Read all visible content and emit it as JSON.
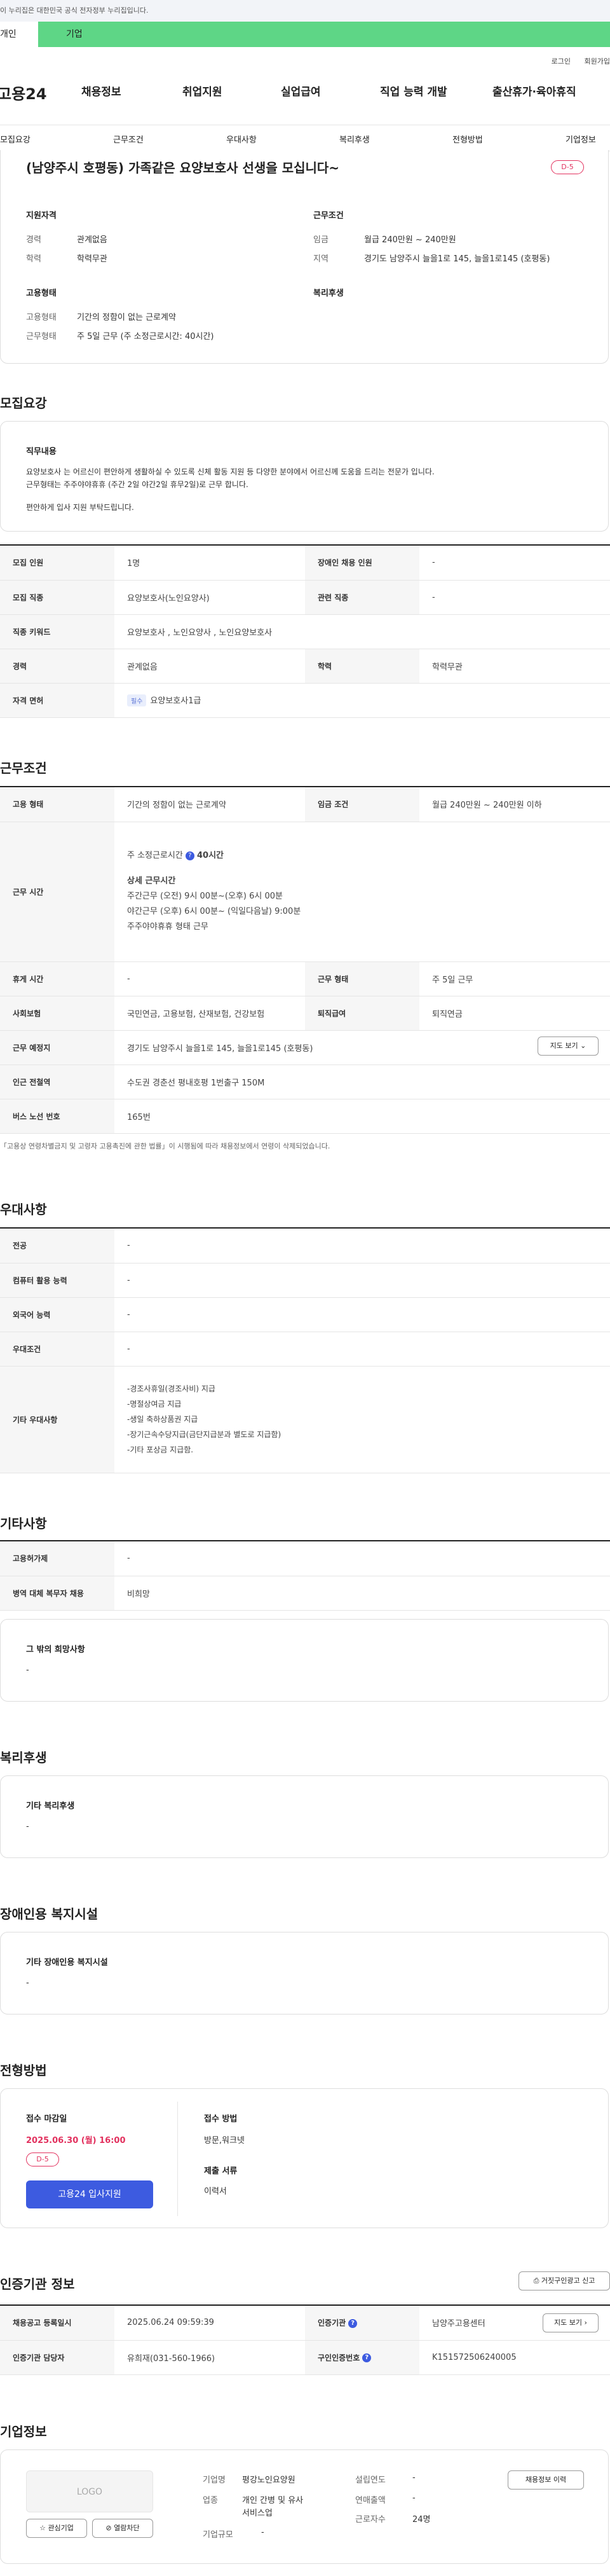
{
  "gov_banner": "이 누리집은 대한민국 공식 전자정부 누리집입니다.",
  "tabs": {
    "individual": "개인",
    "corporate": "기업"
  },
  "util": {
    "login": "로그인",
    "signup": "회원가입"
  },
  "logo": "고용24",
  "gnb": [
    "채용정보",
    "취업지원",
    "실업급여",
    "직업 능력 개발",
    "출산휴가·육아휴직"
  ],
  "lnb": [
    "모집요강",
    "근무조건",
    "우대사항",
    "복리후생",
    "전형방법",
    "기업정보"
  ],
  "title_card": {
    "title": "(남양주시 호평동) 가족같은 요양보호사 선생을 모십니다~",
    "dday": "D-5",
    "qual_h": "지원자격",
    "career_l": "경력",
    "career_v": "관계없음",
    "edu_l": "학력",
    "edu_v": "학력무관",
    "work_h": "근무조건",
    "wage_l": "임금",
    "wage_v": "월급 240만원 ~ 240만원",
    "area_l": "지역",
    "area_v": "경기도 남양주시 늘을1로 145, 늘을1로145 (호평동)",
    "emp_h": "고용형태",
    "emptype_l": "고용형태",
    "emptype_v": "기간의 정함이 없는 근로계약",
    "worktype_l": "근무형태",
    "worktype_v": "주 5일 근무 (주 소정근로시간: 40시간)",
    "welfare_h": "복리후생"
  },
  "recruit": {
    "h": "모집요강",
    "duty_h": "직무내용",
    "duty_1": "요양보호사 는 어르신이 편안하게 생활하실 수 있도록 신체 활동 지원 등 다양한 분야에서 어르신께 도움을 드리는 전문가 입니다.",
    "duty_2": "근무형태는 주주야야휴휴 (주간 2일 야간2일 휴무2일)로 근무 합니다.",
    "duty_3": "편안하게 입사 지원 부탁드립니다.",
    "rows": [
      [
        "모집 인원",
        "1명",
        "장애인 채용 인원",
        "-"
      ],
      [
        "모집 직종",
        "요양보호사(노인요양사)",
        "관련 직종",
        "-"
      ],
      [
        "직종 키워드",
        "요양보호사 , 노인요양사 , 노인요양보호사",
        "",
        ""
      ],
      [
        "경력",
        "관계없음",
        "학력",
        "학력무관"
      ]
    ],
    "license_l": "자격 면허",
    "license_tag": "필수",
    "license_v": "요양보호사1급"
  },
  "cond": {
    "h": "근무조건",
    "emptype_l": "고용 형태",
    "emptype_v": "기간의 정함이 없는 근로계약",
    "wage_l": "임금 조건",
    "wage_v": "월급 240만원 ~ 240만원 이하",
    "hours_l": "근무 시간",
    "hours_1": "주 소정근로시간",
    "hours_1b": "40시간",
    "hours_2": "상세 근무시간",
    "hours_3": "주간근무 (오전) 9시 00분~(오후) 6시 00분",
    "hours_4": "야간근무 (오후) 6시 00분~ (익일다음날) 9:00분",
    "hours_5": "주주야야휴휴 형태 근무",
    "rows": [
      [
        "휴게 시간",
        "-",
        "근무 형태",
        "주 5일 근무"
      ],
      [
        "사회보험",
        "국민연금, 고용보험, 산재보험, 건강보험",
        "퇴직급여",
        "퇴직연금"
      ]
    ],
    "place_l": "근무 예정지",
    "place_v": "경기도 남양주시 늘을1로 145, 늘을1로145 (호평동)",
    "map_btn": "지도 보기",
    "subway_l": "인근 전철역",
    "subway_v": "수도권 경춘선 평내호평 1번출구 150M",
    "bus_l": "버스 노선 번호",
    "bus_v": "165번",
    "note": "「고용상 연령차별금지 및 고령자 고용촉진에 관한 법률」이 시행됨에 따라 채용정보에서 연령이 삭제되었습니다."
  },
  "pref": {
    "h": "우대사항",
    "major_l": "전공",
    "major_v": "-",
    "pc_l": "컴퓨터 활용 능력",
    "pc_v": "-",
    "lang_l": "외국어 능력",
    "lang_v": "-",
    "cond_l": "우대조건",
    "cond_v": "-",
    "etc_l": "기타 우대사항",
    "etc": [
      "-경조사휴일(경조사비) 지급",
      "-명절상여금 지급",
      "-생일 축하상품권 지급",
      "-장기근속수당지급(금단지급분과 별도로 지급함)",
      "-기타 포상금 지급함."
    ]
  },
  "other": {
    "h": "기타사항",
    "hire_l": "고용허가제",
    "hire_v": "-",
    "mil_l": "병역 대체 복무자 채용",
    "mil_v": "비희망",
    "wish_h": "그 밖의 희망사항",
    "wish_v": "-"
  },
  "welfare": {
    "h": "복리후생",
    "sub": "기타 복리후생",
    "v": "-"
  },
  "disab": {
    "h": "장애인용 복지시설",
    "sub": "기타 장애인용 복지시설",
    "v": "-"
  },
  "process": {
    "h": "전형방법",
    "deadline_l": "접수 마감일",
    "deadline_v": "2025.06.30 (월) 16:00",
    "dday": "D-5",
    "apply_btn": "고용24 입사지원",
    "method_l": "접수 방법",
    "method_v": "방문,워크넷",
    "docs_l": "제출 서류",
    "docs_v": "이력서"
  },
  "cert": {
    "h": "인증기관 정보",
    "report_btn": "거짓구인광고 신고",
    "reg_l": "채용공고 등록일시",
    "reg_v": "2025.06.24 09:59:39",
    "org_l": "인증기관",
    "org_v": "남양주고용센터",
    "map_btn": "지도 보기",
    "mgr_l": "인증기관 담당자",
    "mgr_v": "유희재(031-560-1966)",
    "no_l": "구인인증번호",
    "no_v": "K151572506240005"
  },
  "company": {
    "h": "기업정보",
    "logo": "LOGO",
    "fav_btn": "관심기업",
    "block_btn": "열람차단",
    "name_l": "기업명",
    "name_v": "평강노인요양원",
    "ind_l": "업종",
    "ind_v1": "개인 간병 및 유사",
    "ind_v2": "서비스업",
    "size_l": "기업규모",
    "size_v": "-",
    "est_l": "설립연도",
    "est_v": "-",
    "rev_l": "연매출액",
    "rev_v": "-",
    "emp_l": "근로자수",
    "emp_v": "24명",
    "history_btn": "채용정보 이력"
  }
}
